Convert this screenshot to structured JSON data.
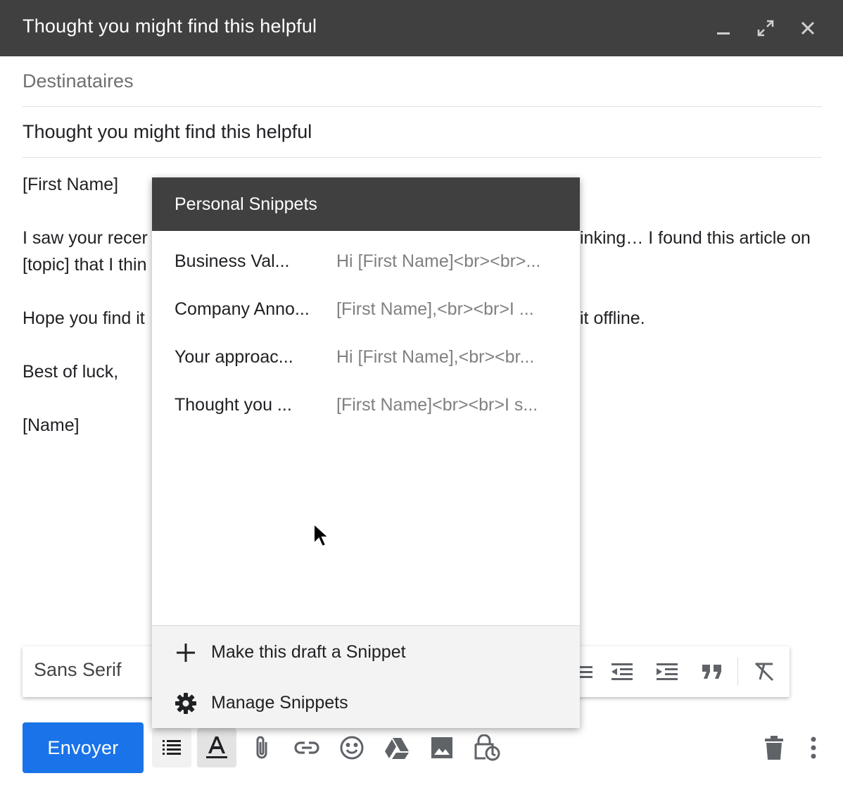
{
  "window": {
    "title": "Thought you might find this helpful",
    "minimize_icon": "minimize-icon",
    "expand_icon": "expand-icon",
    "close_icon": "close-icon"
  },
  "compose": {
    "recipients_placeholder": "Destinataires",
    "subject": "Thought you might find this helpful",
    "body_lines": [
      "[First Name]",
      "I saw your recer",
      "inking… I found this article on",
      "[topic] that I thin",
      "Hope you find it",
      "it offline.",
      "Best of luck,",
      "[Name]"
    ]
  },
  "snippets": {
    "header": "Personal Snippets",
    "items": [
      {
        "name": "Business Val...",
        "preview": "Hi [First Name]<br><br>..."
      },
      {
        "name": "Company Anno...",
        "preview": "[First Name],<br><br>I ..."
      },
      {
        "name": "Your approac...",
        "preview": "Hi [First Name],<br><br..."
      },
      {
        "name": "Thought you ...",
        "preview": "[First Name]<br><br>I s..."
      }
    ],
    "footer": {
      "make_snippet": "Make this draft a Snippet",
      "manage": "Manage Snippets"
    }
  },
  "format_toolbar": {
    "font": "Sans Serif",
    "icons": [
      "bulleted-list-icon",
      "indent-less-icon",
      "indent-more-icon",
      "quote-icon",
      "remove-formatting-icon"
    ]
  },
  "bottom_bar": {
    "send_label": "Envoyer",
    "icons": [
      "snippets-icon",
      "formatting-icon",
      "attach-icon",
      "link-icon",
      "emoji-icon",
      "drive-icon",
      "photo-icon",
      "confidential-icon",
      "trash-icon",
      "more-options-icon"
    ]
  },
  "colors": {
    "titlebar": "#404040",
    "send_button": "#1a73e8",
    "preview_text": "#808080"
  }
}
